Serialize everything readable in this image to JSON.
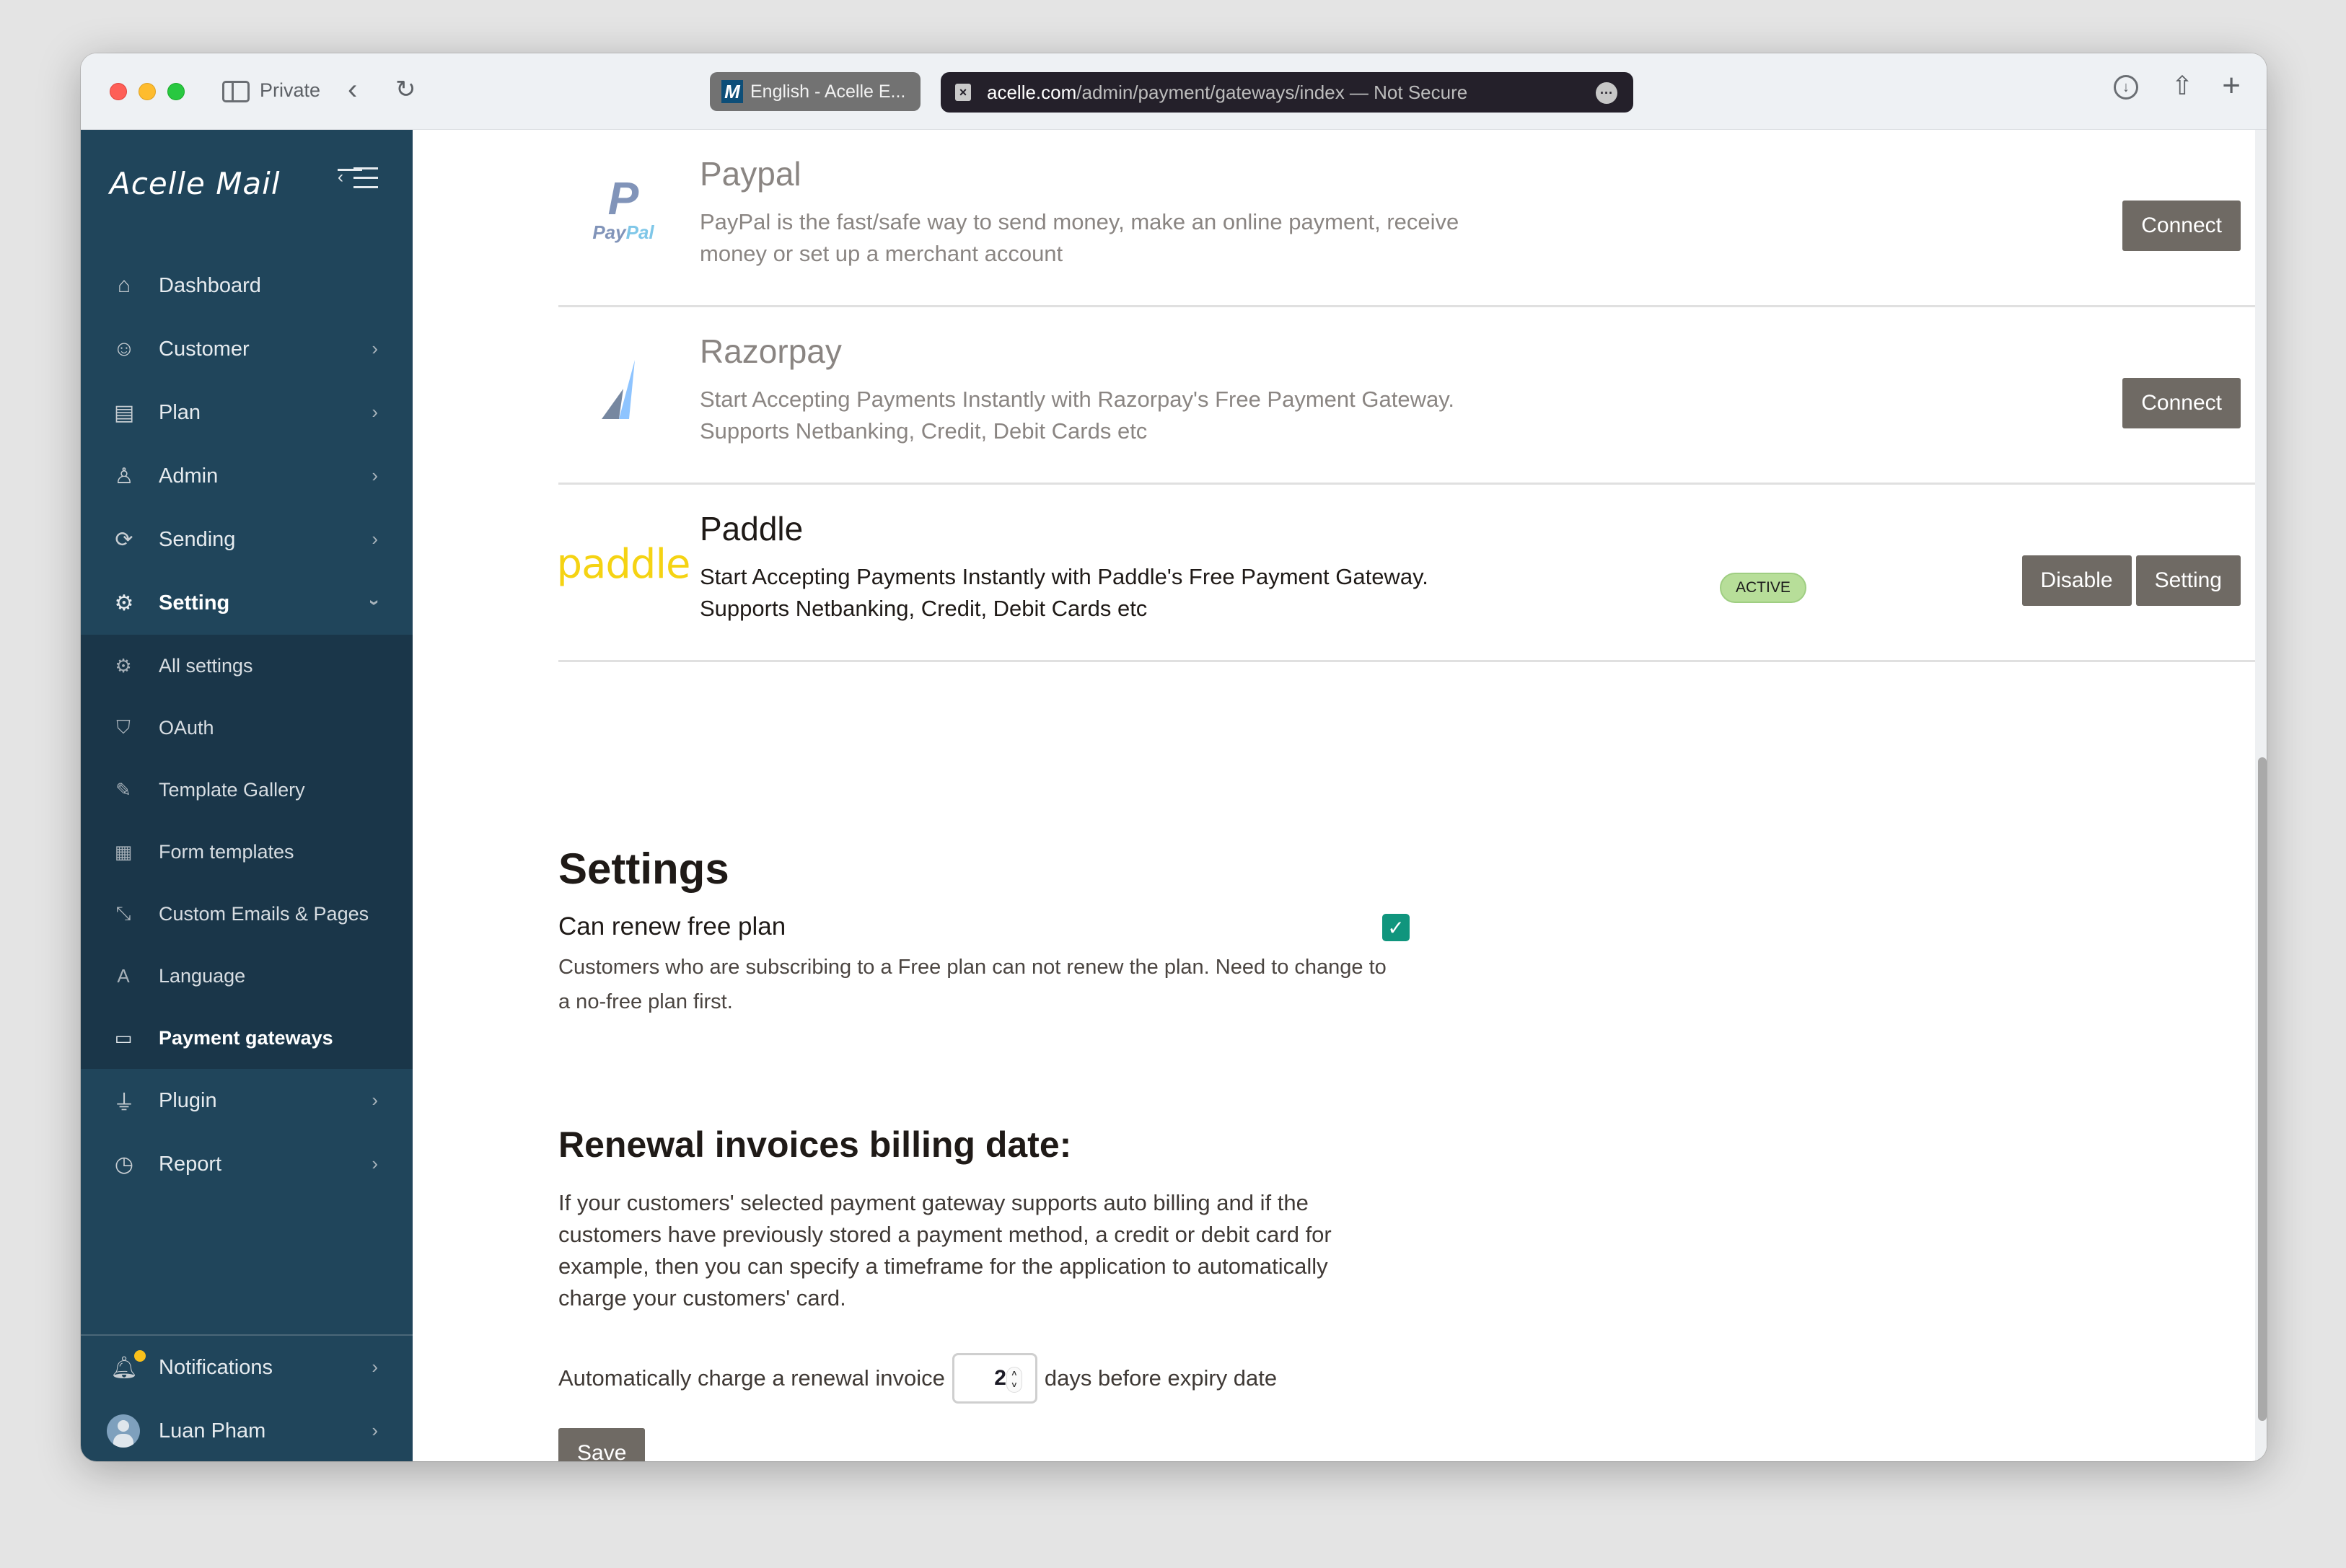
{
  "browser": {
    "private_label": "Private",
    "tab_title": "English - Acelle E...",
    "url_domain": "acelle.com",
    "url_path": "/admin/payment/gateways/index — Not Secure"
  },
  "sidebar": {
    "logo": "Acelle Mail",
    "items": [
      {
        "label": "Dashboard",
        "icon": "home-icon",
        "has_chevron": false
      },
      {
        "label": "Customer",
        "icon": "customer-icon",
        "has_chevron": true
      },
      {
        "label": "Plan",
        "icon": "plan-icon",
        "has_chevron": true
      },
      {
        "label": "Admin",
        "icon": "admin-icon",
        "has_chevron": true
      },
      {
        "label": "Sending",
        "icon": "sending-icon",
        "has_chevron": true
      },
      {
        "label": "Setting",
        "icon": "gear-icon",
        "expanded": true
      }
    ],
    "setting_submenu": [
      {
        "label": "All settings",
        "icon": "settings-gear-icon"
      },
      {
        "label": "OAuth",
        "icon": "oauth-shield-icon"
      },
      {
        "label": "Template Gallery",
        "icon": "template-brush-icon"
      },
      {
        "label": "Form templates",
        "icon": "form-template-icon"
      },
      {
        "label": "Custom Emails & Pages",
        "icon": "custom-pages-icon"
      },
      {
        "label": "Language",
        "icon": "language-icon"
      },
      {
        "label": "Payment gateways",
        "icon": "credit-card-icon",
        "active": true
      }
    ],
    "items_after": [
      {
        "label": "Plugin",
        "icon": "plug-icon"
      },
      {
        "label": "Report",
        "icon": "report-clock-icon"
      }
    ],
    "bottom": {
      "notifications": "Notifications",
      "user": "Luan Pham"
    }
  },
  "gateways": [
    {
      "name": "Paypal",
      "description": "PayPal is the fast/safe way to send money, make an online payment, receive money or set up a merchant account",
      "status": "",
      "actions": [
        "Connect"
      ]
    },
    {
      "name": "Razorpay",
      "description": "Start Accepting Payments Instantly with Razorpay's Free Payment Gateway. Supports Netbanking, Credit, Debit Cards etc",
      "status": "",
      "actions": [
        "Connect"
      ]
    },
    {
      "name": "Paddle",
      "description": "Start Accepting Payments Instantly with Paddle's Free Payment Gateway. Supports Netbanking, Credit, Debit Cards etc",
      "status": "ACTIVE",
      "actions": [
        "Disable",
        "Setting"
      ]
    }
  ],
  "logos": {
    "paypal_p": "P",
    "paypal_pay": "Pay",
    "paypal_pal": "Pal",
    "paddle": "paddle"
  },
  "settings": {
    "title": "Settings",
    "can_renew_free_plan": {
      "label": "Can renew free plan",
      "checked": true,
      "help": "Customers who are subscribing to a Free plan can not renew the plan. Need to change to a no-free plan first."
    }
  },
  "renewal": {
    "title": "Renewal invoices billing date:",
    "description": "If your customers' selected payment gateway supports auto billing and if the customers have previously stored a payment method, a credit or debit card for example, then you can specify a timeframe for the application to automatically charge your customers' card.",
    "prefix": "Automatically charge a renewal invoice",
    "days_value": "2",
    "suffix": "days before expiry date",
    "save_label": "Save"
  },
  "colors": {
    "sidebar_bg": "#20455b",
    "submenu_bg": "#1a3649",
    "button_bg": "#6f6a64",
    "active_badge": "#b7de99",
    "checkbox": "#10957d"
  }
}
